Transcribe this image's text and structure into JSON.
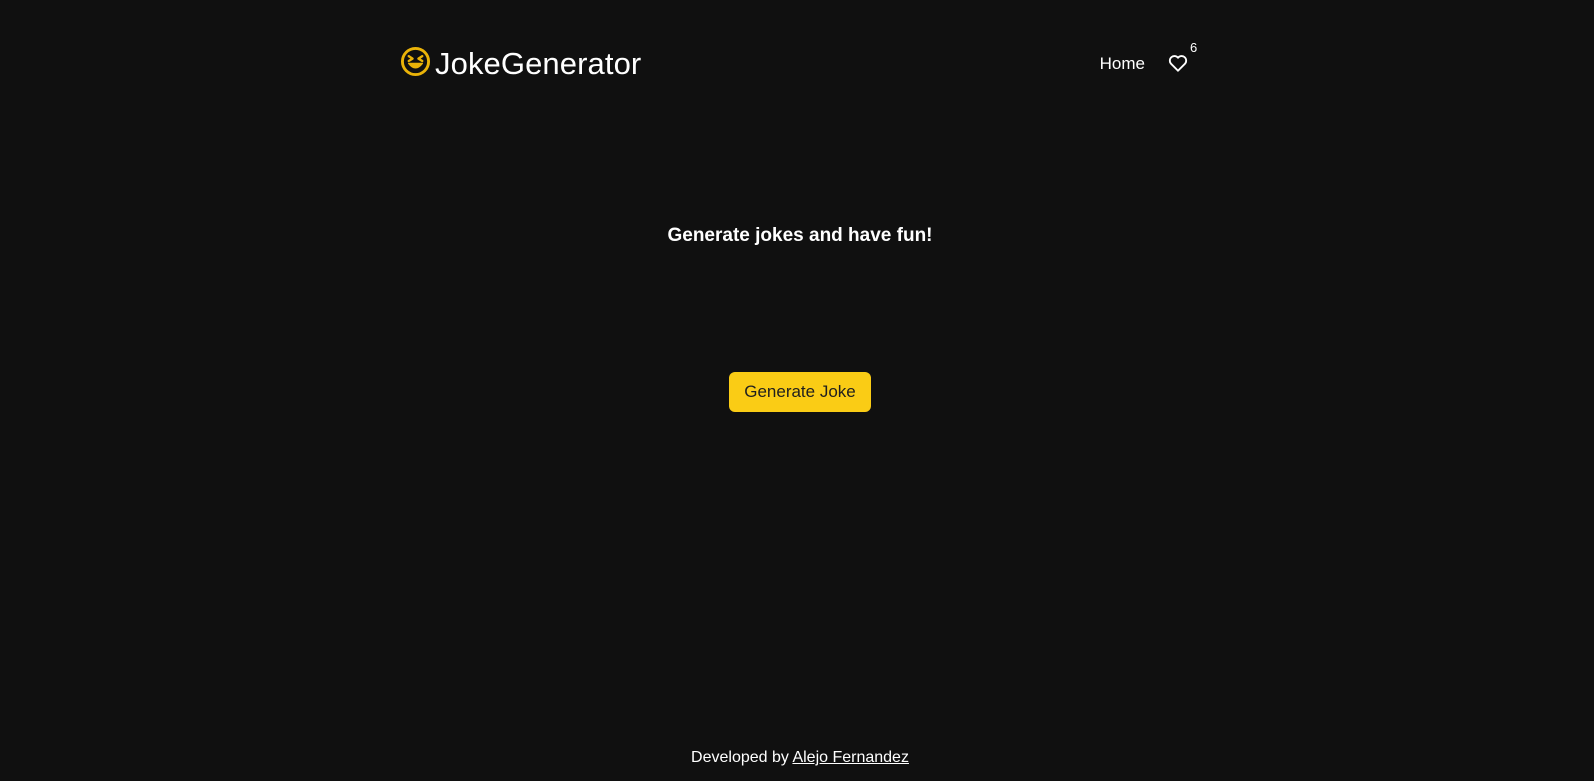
{
  "header": {
    "brand_icon": "laughing-face-icon",
    "brand_name": "JokeGenerator",
    "nav": {
      "home_label": "Home",
      "favorites_icon": "heart-icon",
      "favorites_count": "6"
    }
  },
  "main": {
    "heading": "Generate jokes and have fun!",
    "generate_button_label": "Generate Joke"
  },
  "footer": {
    "prefix": "Developed by",
    "author_link": "Alejo Fernandez"
  },
  "colors": {
    "background": "#101010",
    "accent": "#facc15",
    "text": "#ffffff"
  }
}
